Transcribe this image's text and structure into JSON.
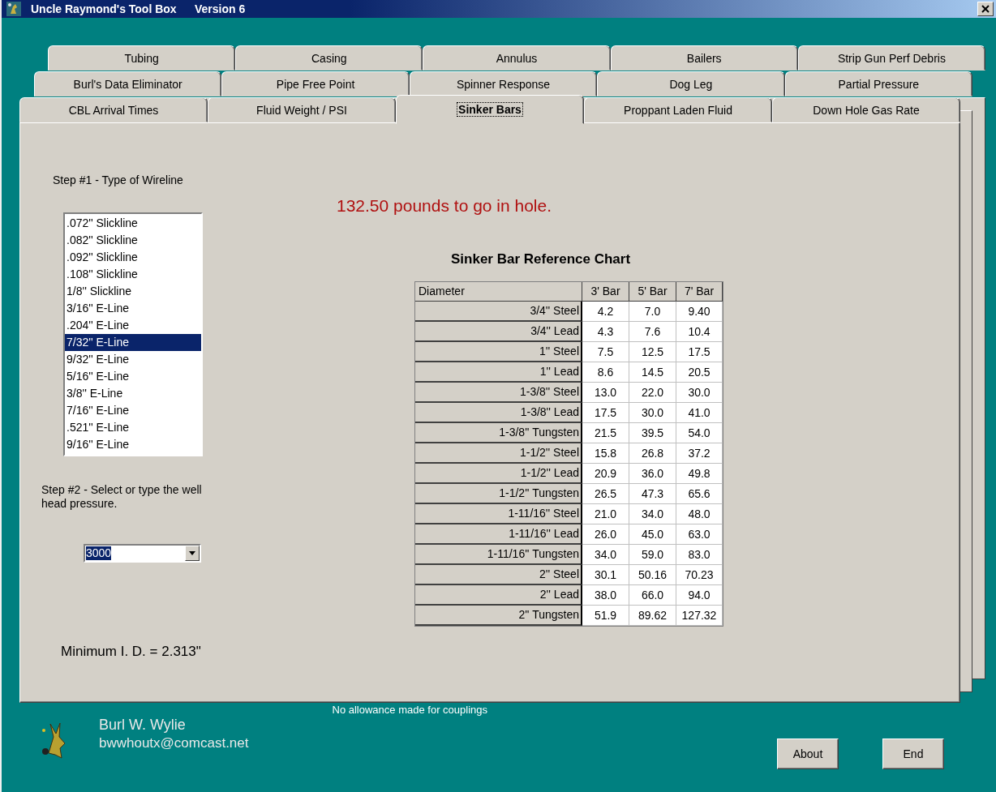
{
  "window": {
    "title": "Uncle Raymond's Tool Box",
    "version": "Version 6"
  },
  "tab_rows": [
    {
      "tabs": [
        {
          "label": "Tubing",
          "selected": false
        },
        {
          "label": "Casing",
          "selected": false
        },
        {
          "label": "Annulus",
          "selected": false
        },
        {
          "label": "Bailers",
          "selected": false
        },
        {
          "label": "Strip Gun Perf Debris",
          "selected": false
        }
      ]
    },
    {
      "tabs": [
        {
          "label": "Burl's Data Eliminator",
          "selected": false
        },
        {
          "label": "Pipe Free Point",
          "selected": false
        },
        {
          "label": "Spinner Response",
          "selected": false
        },
        {
          "label": "Dog Leg",
          "selected": false
        },
        {
          "label": "Partial Pressure",
          "selected": false
        }
      ]
    },
    {
      "tabs": [
        {
          "label": "CBL Arrival Times",
          "selected": false
        },
        {
          "label": "Fluid Weight / PSI",
          "selected": false
        },
        {
          "label": "Sinker Bars",
          "selected": true
        },
        {
          "label": "Proppant Laden Fluid",
          "selected": false
        },
        {
          "label": "Down Hole Gas Rate",
          "selected": false
        }
      ]
    }
  ],
  "step1": {
    "label": "Step #1 - Type of Wireline",
    "items": [
      {
        "label": ".072'' Slickline",
        "selected": false
      },
      {
        "label": ".082'' Slickline",
        "selected": false
      },
      {
        "label": ".092'' Slickline",
        "selected": false
      },
      {
        "label": ".108'' Slickline",
        "selected": false
      },
      {
        "label": "1/8'' Slickline",
        "selected": false
      },
      {
        "label": "3/16'' E-Line",
        "selected": false
      },
      {
        "label": ".204'' E-Line",
        "selected": false
      },
      {
        "label": "7/32'' E-Line",
        "selected": true
      },
      {
        "label": "9/32'' E-Line",
        "selected": false
      },
      {
        "label": "5/16'' E-Line",
        "selected": false
      },
      {
        "label": "3/8'' E-Line",
        "selected": false
      },
      {
        "label": "7/16'' E-Line",
        "selected": false
      },
      {
        "label": ".521'' E-Line",
        "selected": false
      },
      {
        "label": "9/16'' E-Line",
        "selected": false
      }
    ]
  },
  "step2": {
    "label": "Step #2 - Select or type the well head pressure.",
    "value": "3000"
  },
  "minimum_id": "Minimum I. D. = 2.313\"",
  "result": "132.50 pounds to go in hole.",
  "chart": {
    "title": "Sinker Bar Reference Chart",
    "columns": [
      "Diameter",
      "3' Bar",
      "5' Bar",
      "7' Bar"
    ],
    "rows": [
      [
        "3/4'' Steel",
        "4.2",
        "7.0",
        "9.40"
      ],
      [
        "3/4'' Lead",
        "4.3",
        "7.6",
        "10.4"
      ],
      [
        "1'' Steel",
        "7.5",
        "12.5",
        "17.5"
      ],
      [
        "1'' Lead",
        "8.6",
        "14.5",
        "20.5"
      ],
      [
        "1-3/8'' Steel",
        "13.0",
        "22.0",
        "30.0"
      ],
      [
        "1-3/8'' Lead",
        "17.5",
        "30.0",
        "41.0"
      ],
      [
        "1-3/8'' Tungsten",
        "21.5",
        "39.5",
        "54.0"
      ],
      [
        "1-1/2'' Steel",
        "15.8",
        "26.8",
        "37.2"
      ],
      [
        "1-1/2'' Lead",
        "20.9",
        "36.0",
        "49.8"
      ],
      [
        "1-1/2'' Tungsten",
        "26.5",
        "47.3",
        "65.6"
      ],
      [
        "1-11/16'' Steel",
        "21.0",
        "34.0",
        "48.0"
      ],
      [
        "1-11/16'' Lead",
        "26.0",
        "45.0",
        "63.0"
      ],
      [
        "1-11/16'' Tungsten",
        "34.0",
        "59.0",
        "83.0"
      ],
      [
        "2'' Steel",
        "30.1",
        "50.16",
        "70.23"
      ],
      [
        "2'' Lead",
        "38.0",
        "66.0",
        "94.0"
      ],
      [
        "2'' Tungsten",
        "51.9",
        "89.62",
        "127.32"
      ]
    ]
  },
  "footer": {
    "note": "No allowance made for couplings",
    "author": "Burl W. Wylie",
    "email": "bwwhoutx@comcast.net",
    "buttons": [
      "About",
      "End"
    ]
  }
}
